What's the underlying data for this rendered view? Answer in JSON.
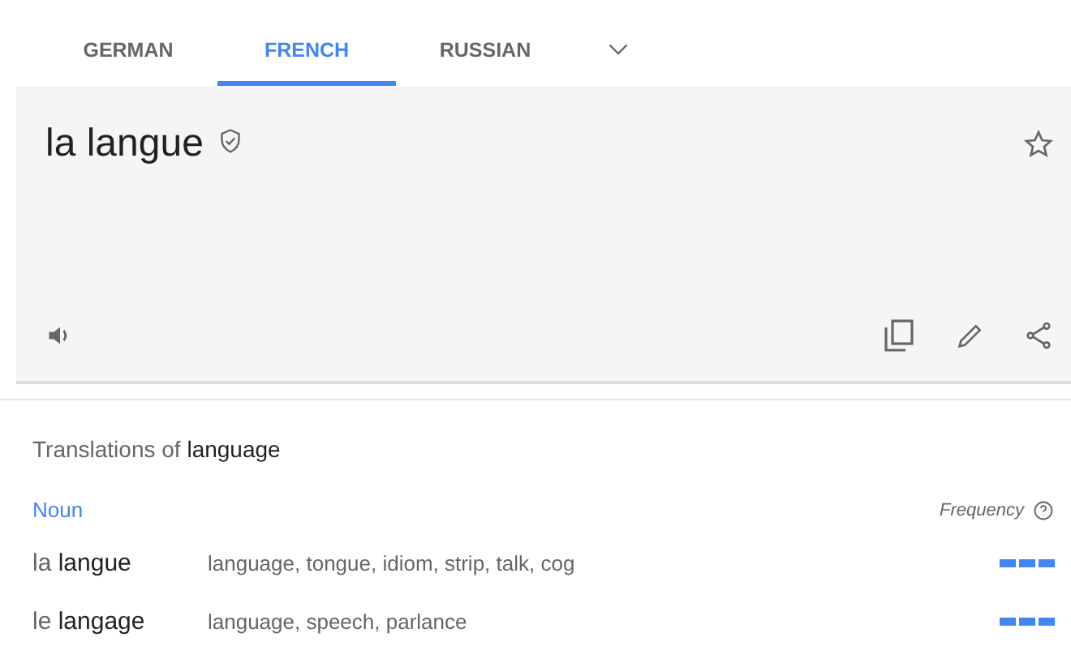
{
  "tabs": [
    {
      "label": "GERMAN",
      "selected": false
    },
    {
      "label": "FRENCH",
      "selected": true
    },
    {
      "label": "RUSSIAN",
      "selected": false
    }
  ],
  "result": {
    "text": "la langue"
  },
  "translations": {
    "heading": "Translations of **language**",
    "part_of_speech": "Noun",
    "frequency_label": "Frequency",
    "rows": [
      {
        "word": "la **langue**",
        "meanings": "language, tongue, idiom, strip, talk, cog",
        "level": 1
      },
      {
        "word": "le **langage**",
        "meanings": "language, speech, parlance",
        "level": 1
      }
    ]
  }
}
